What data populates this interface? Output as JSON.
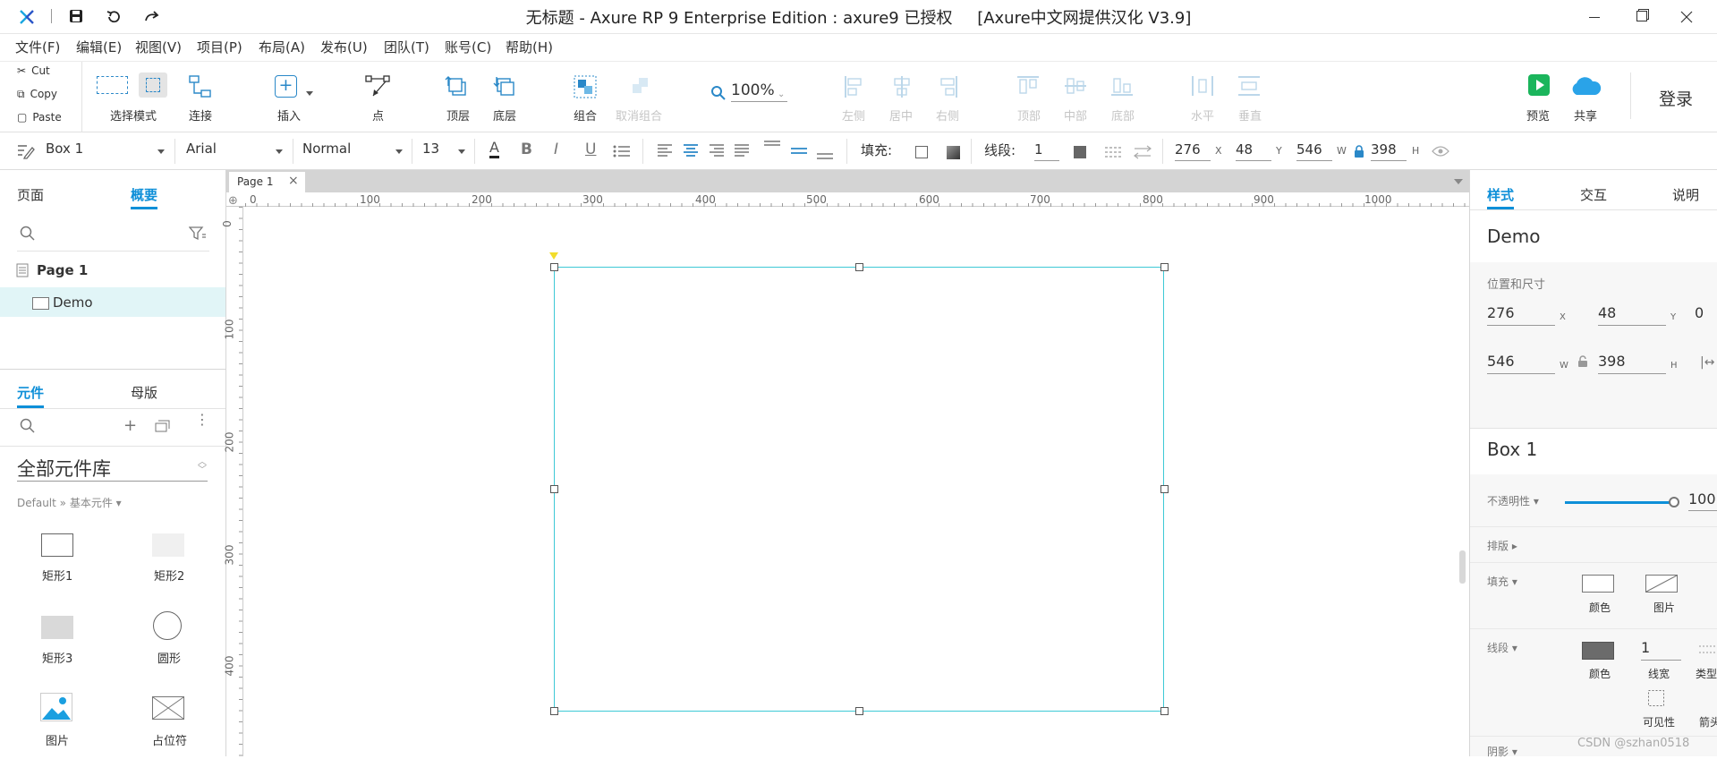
{
  "window": {
    "title": "无标题 - Axure RP 9 Enterprise Edition : axure9 已授权",
    "subtitle": "[Axure中文网提供汉化 V3.9]"
  },
  "menu": [
    "文件(F)",
    "编辑(E)",
    "视图(V)",
    "项目(P)",
    "布局(A)",
    "发布(U)",
    "团队(T)",
    "账号(C)",
    "帮助(H)"
  ],
  "clipboard": {
    "cut": "Cut",
    "copy": "Copy",
    "paste": "Paste"
  },
  "toolbar": {
    "select_mode": "选择模式",
    "connect": "连接",
    "insert": "插入",
    "point": "点",
    "top_layer": "顶层",
    "bottom_layer": "底层",
    "zoom": "100%",
    "group": "组合",
    "ungroup": "取消组合",
    "left": "左侧",
    "center": "居中",
    "right": "右侧",
    "top": "顶部",
    "middle": "中部",
    "bottom": "底部",
    "horizontal": "水平",
    "vertical": "垂直",
    "preview": "预览",
    "share": "共享",
    "login": "登录"
  },
  "format": {
    "widget_name": "Box 1",
    "font": "Arial",
    "style": "Normal",
    "size": "13",
    "fill_label": "填充:",
    "line_label": "线段:",
    "line_width": "1",
    "x": "276",
    "y": "48",
    "w": "546",
    "h": "398",
    "x_label": "X",
    "y_label": "Y",
    "w_label": "W",
    "h_label": "H"
  },
  "left": {
    "tab_pages": "页面",
    "tab_outline": "概要",
    "page_name": "Page 1",
    "item_name": "Demo",
    "tab_widgets": "元件",
    "tab_masters": "母版",
    "library": "全部元件库",
    "breadcrumb": "Default » 基本元件 ▾",
    "widgets": [
      {
        "label": "矩形1",
        "icon": "rect1"
      },
      {
        "label": "矩形2",
        "icon": "rect2"
      },
      {
        "label": "矩形3",
        "icon": "rect3"
      },
      {
        "label": "圆形",
        "icon": "circle"
      },
      {
        "label": "图片",
        "icon": "image"
      },
      {
        "label": "占位符",
        "icon": "placeholder"
      }
    ]
  },
  "canvas": {
    "tab": "Page 1",
    "ruler_h": [
      "0",
      "100",
      "200",
      "300",
      "400",
      "500",
      "600",
      "700",
      "800",
      "900",
      "1000"
    ],
    "ruler_v": [
      "0",
      "100",
      "200",
      "300",
      "400"
    ]
  },
  "right": {
    "tab_style": "样式",
    "tab_interact": "交互",
    "tab_notes": "说明",
    "page_title": "Demo",
    "pos_size_label": "位置和尺寸",
    "x": "276",
    "y": "48",
    "rot": "0",
    "w": "546",
    "h": "398",
    "x_label": "X",
    "y_label": "Y",
    "w_label": "W",
    "h_label": "H",
    "widget_title": "Box 1",
    "opacity_label": "不透明性 ▾",
    "opacity_value": "100",
    "opacity_level": 1.0,
    "typography_label": "排版 ▸",
    "fill_label": "填充 ▾",
    "fill_color": "颜色",
    "fill_image": "图片",
    "border_label": "线段 ▾",
    "border_color": "颜色",
    "border_width": "1",
    "border_width_label": "线宽",
    "border_type": "类型",
    "visibility": "可见性",
    "arrow": "箭头",
    "shadow_label": "阴影 ▾"
  },
  "watermark": "CSDN @szhan0518",
  "colors": {
    "accent": "#0e8fd8",
    "selection": "#3ec9d6",
    "preview_green": "#1bb55c",
    "share_blue": "#2aa3e8"
  }
}
